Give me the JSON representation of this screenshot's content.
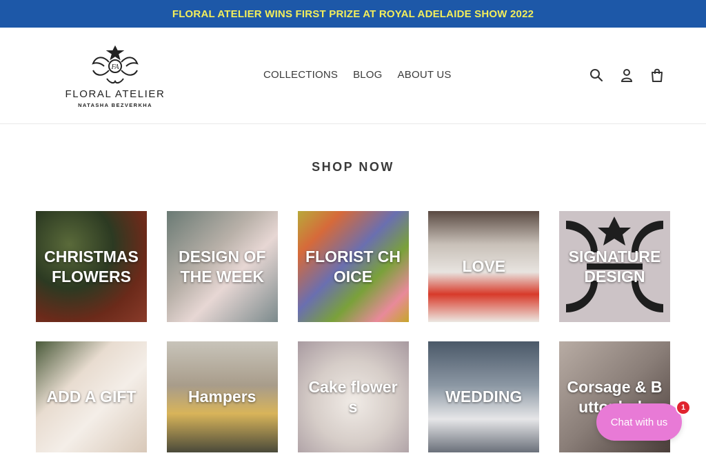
{
  "announcement": "FLORAL ATELIER WINS FIRST PRIZE AT ROYAL ADELAIDE SHOW 2022",
  "logo": {
    "brand": "FLORAL ATELIER",
    "subtitle": "NATASHA BEZVERKHA"
  },
  "nav": {
    "items": [
      "COLLECTIONS",
      "BLOG",
      "ABOUT US"
    ]
  },
  "header_icons": [
    "search-icon",
    "account-icon",
    "cart-icon"
  ],
  "section_title": "SHOP NOW",
  "collections": [
    {
      "label": "CHRISTMAS FLOWERS"
    },
    {
      "label": "DESIGN OF THE WEEK"
    },
    {
      "label": "FLORIST CHOICE"
    },
    {
      "label": "LOVE"
    },
    {
      "label": "SIGNATURE DESIGN"
    },
    {
      "label": "ADD A GIFT"
    },
    {
      "label": "Hampers"
    },
    {
      "label": "Cake flowers"
    },
    {
      "label": "WEDDING"
    },
    {
      "label": "Corsage & Buttonhole"
    }
  ],
  "chat": {
    "label": "Chat with us",
    "badge": "1"
  },
  "colors": {
    "announcement_bg": "#1d58a8",
    "announcement_text": "#f4ef5a",
    "chat_button": "#e87ad6",
    "badge": "#e0242e"
  }
}
